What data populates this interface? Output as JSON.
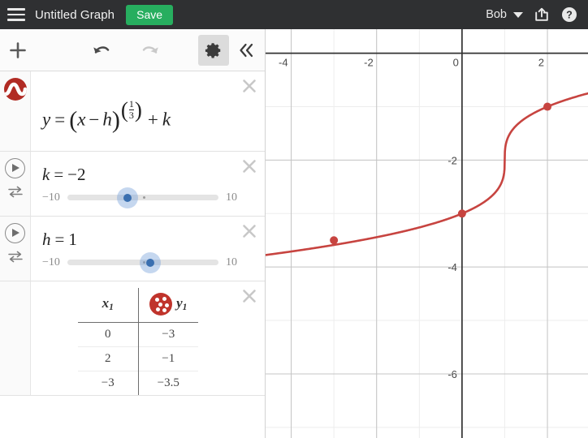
{
  "header": {
    "menu_icon": "hamburger-icon",
    "title": "Untitled Graph",
    "save_label": "Save",
    "user_name": "Bob",
    "caret_icon": "chevron-down-icon",
    "share_icon": "share-icon",
    "help_icon": "help-icon"
  },
  "toolbar": {
    "add_icon": "plus-icon",
    "undo_icon": "undo-icon",
    "redo_icon": "redo-icon",
    "settings_icon": "gear-icon",
    "collapse_icon": "double-chevron-left-icon",
    "settings_active": true,
    "redo_disabled": true
  },
  "expressions": [
    {
      "index": "1",
      "type": "equation",
      "swatch_icon": "curve-color-swatch",
      "swatch_color": "#b12b24",
      "lhs": "y",
      "equals": "=",
      "open_paren": "(",
      "base_x": "x",
      "minus": "−",
      "base_h": "h",
      "close_paren": ")",
      "exp_open": "(",
      "exp_num": "1",
      "exp_den": "3",
      "exp_close": ")",
      "plus": "+",
      "addend": "k",
      "close_icon": "close-icon"
    },
    {
      "index": "2",
      "type": "slider",
      "play_icon": "play-icon",
      "shuffle_icon": "shuffle-icon",
      "name": "k",
      "equals": "=",
      "value": "−2",
      "min_label": "−10",
      "max_label": "10",
      "min": -10,
      "max": 10,
      "current": -2,
      "tick": 0,
      "close_icon": "close-icon"
    },
    {
      "index": "3",
      "type": "slider",
      "play_icon": "play-icon",
      "shuffle_icon": "shuffle-icon",
      "name": "h",
      "equals": "=",
      "value": "1",
      "min_label": "−10",
      "max_label": "10",
      "min": -10,
      "max": 10,
      "current": 1,
      "tick": 0,
      "close_icon": "close-icon"
    },
    {
      "index": "4",
      "type": "table",
      "swatch_icon": "points-color-swatch",
      "swatch_color": "#c0342c",
      "col1_label": "x",
      "col1_sub": "1",
      "col2_label": "y",
      "col2_sub": "1",
      "rows": [
        {
          "x": "0",
          "y": "−3"
        },
        {
          "x": "2",
          "y": "−1"
        },
        {
          "x": "−3",
          "y": "−3.5"
        }
      ],
      "close_icon": "close-icon"
    }
  ],
  "chart_data": {
    "type": "line",
    "title": "",
    "xlabel": "",
    "ylabel": "",
    "curve_label": "y = (x - h)^(1/3) + k",
    "parameters": {
      "h": 1,
      "k": -2
    },
    "xlim": [
      -4.6,
      2.95
    ],
    "ylim": [
      -7.2,
      0.45
    ],
    "x_ticks": [
      -4,
      -2,
      0,
      2
    ],
    "x_tick_labels": [
      "-4",
      "-2",
      "0",
      "2"
    ],
    "y_ticks": [
      -2,
      -4,
      -6
    ],
    "y_tick_labels": [
      "-2",
      "-4",
      "-6"
    ],
    "grid": true,
    "minor_grid_step": 1,
    "major_grid_step": 2,
    "legend": "none",
    "curve_color": "#c74440",
    "point_color": "#c74440",
    "points": [
      {
        "x": 0,
        "y": -3
      },
      {
        "x": 2,
        "y": -1
      },
      {
        "x": -3,
        "y": -3.5
      }
    ]
  }
}
